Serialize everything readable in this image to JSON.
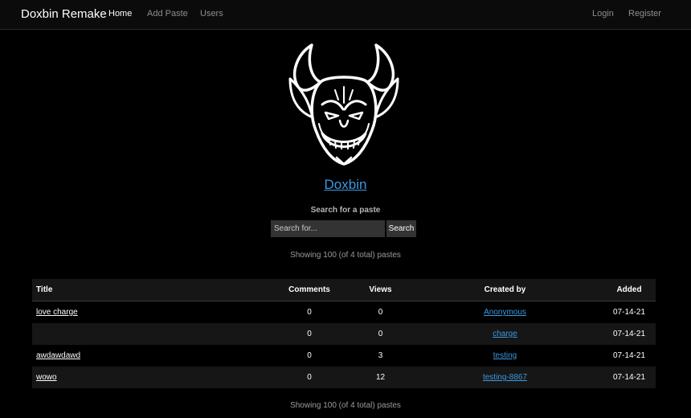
{
  "navbar": {
    "brand": "Doxbin Remake",
    "links": [
      {
        "label": "Home"
      },
      {
        "label": "Add Paste"
      },
      {
        "label": "Users"
      }
    ],
    "right_links": [
      {
        "label": "Login"
      },
      {
        "label": "Register"
      }
    ]
  },
  "hero": {
    "logo_icon": "demon-head-logo",
    "site_name": "Doxbin"
  },
  "search": {
    "label": "Search for a paste",
    "placeholder": "Search for...",
    "button_label": "Search"
  },
  "summary": {
    "top": "Showing 100 (of 4 total) pastes",
    "bottom": "Showing 100 (of 4 total) pastes"
  },
  "table": {
    "columns": [
      "Title",
      "Comments",
      "Views",
      "Created by",
      "Added"
    ],
    "rows": [
      {
        "title": "love charge",
        "comments": "0",
        "views": "0",
        "created_by": "Anonymous",
        "added": "07-14-21"
      },
      {
        "title": "",
        "comments": "0",
        "views": "0",
        "created_by": "charge",
        "added": "07-14-21"
      },
      {
        "title": "awdawdawd",
        "comments": "0",
        "views": "3",
        "created_by": "testing",
        "added": "07-14-21"
      },
      {
        "title": "wowo",
        "comments": "0",
        "views": "12",
        "created_by": "testing-8867",
        "added": "07-14-21"
      }
    ]
  },
  "colors": {
    "background": "#000000",
    "link_blue": "#3b9ae1",
    "row_alt": "#161616"
  }
}
